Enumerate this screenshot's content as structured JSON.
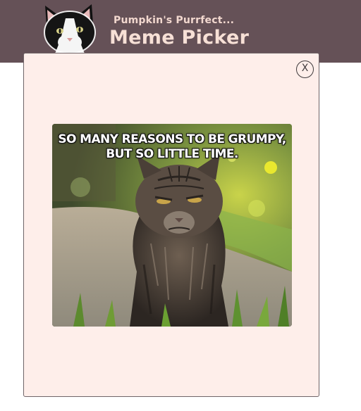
{
  "app": {
    "subtitle": "Pumpkin's Purrfect...",
    "title": "Meme Picker"
  },
  "modal": {
    "close_label": "X",
    "meme": {
      "caption_line_1": "SO MANY REASONS TO BE GRUMPY,",
      "caption_line_2": "BUT SO LITTLE TIME."
    }
  },
  "colors": {
    "header_bg": "#655157",
    "header_text": "#f7e0d6",
    "modal_bg": "#feeeea",
    "modal_border": "#6f6468"
  }
}
